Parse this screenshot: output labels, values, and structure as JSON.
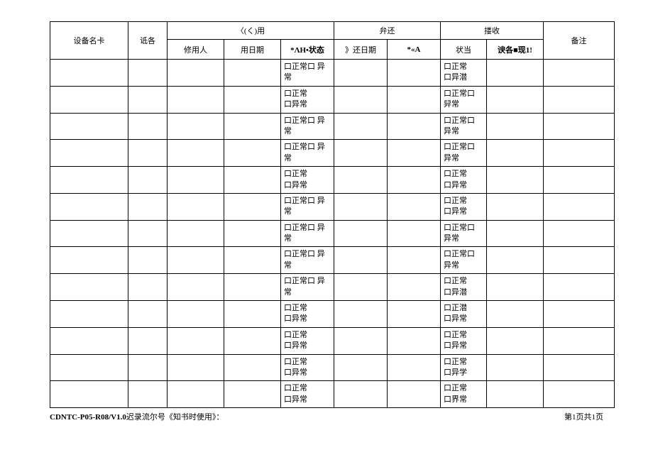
{
  "headers": {
    "device": "设备名卡",
    "shige": "诋各",
    "borrow_group": "〈(く)用",
    "return_group": "弁还",
    "receive_group": "搂收",
    "remark": "备注",
    "user": "修用人",
    "use_date": "用日期",
    "status1": "*ΛH•状态",
    "return_date": "》还日期",
    "a_col": "*«A",
    "status2": "状当",
    "finding": "谀各■现1!"
  },
  "rows": [
    {
      "s1": "口正常口 异常",
      "s2": "口正常\n口异潜"
    },
    {
      "s1": "口正常\n口异常",
      "s2": "口正常口 舁常"
    },
    {
      "s1": "口正常口 异常",
      "s2": "口正常口 异常"
    },
    {
      "s1": "口正常口 异常",
      "s2": "口正常口 异常"
    },
    {
      "s1": "口正常\n口异常",
      "s2": "口正常\n口异常"
    },
    {
      "s1": "口正常口 异常",
      "s2": "口正常\n口异常"
    },
    {
      "s1": "口正常口 异常",
      "s2": "口正常口 异常"
    },
    {
      "s1": "口正常口 异常",
      "s2": "口正常口 异常"
    },
    {
      "s1": "口正常口 异常",
      "s2": "口正常\n口异潜"
    },
    {
      "s1": "口正常\n口异常",
      "s2": "口正潜\n口异常"
    },
    {
      "s1": "口正常\n口异常",
      "s2": "口正常\n口异常"
    },
    {
      "s1": "口正常\n口异常",
      "s2": "口正常\n口异学"
    },
    {
      "s1": "口正常\n口异常",
      "s2": "口正常\n口界常"
    }
  ],
  "footer": {
    "code": "CDNTC-P05-R08/V1.0",
    "code_suffix": "迟录流尔号《知书时使用》：",
    "page": "第1页共1页"
  }
}
